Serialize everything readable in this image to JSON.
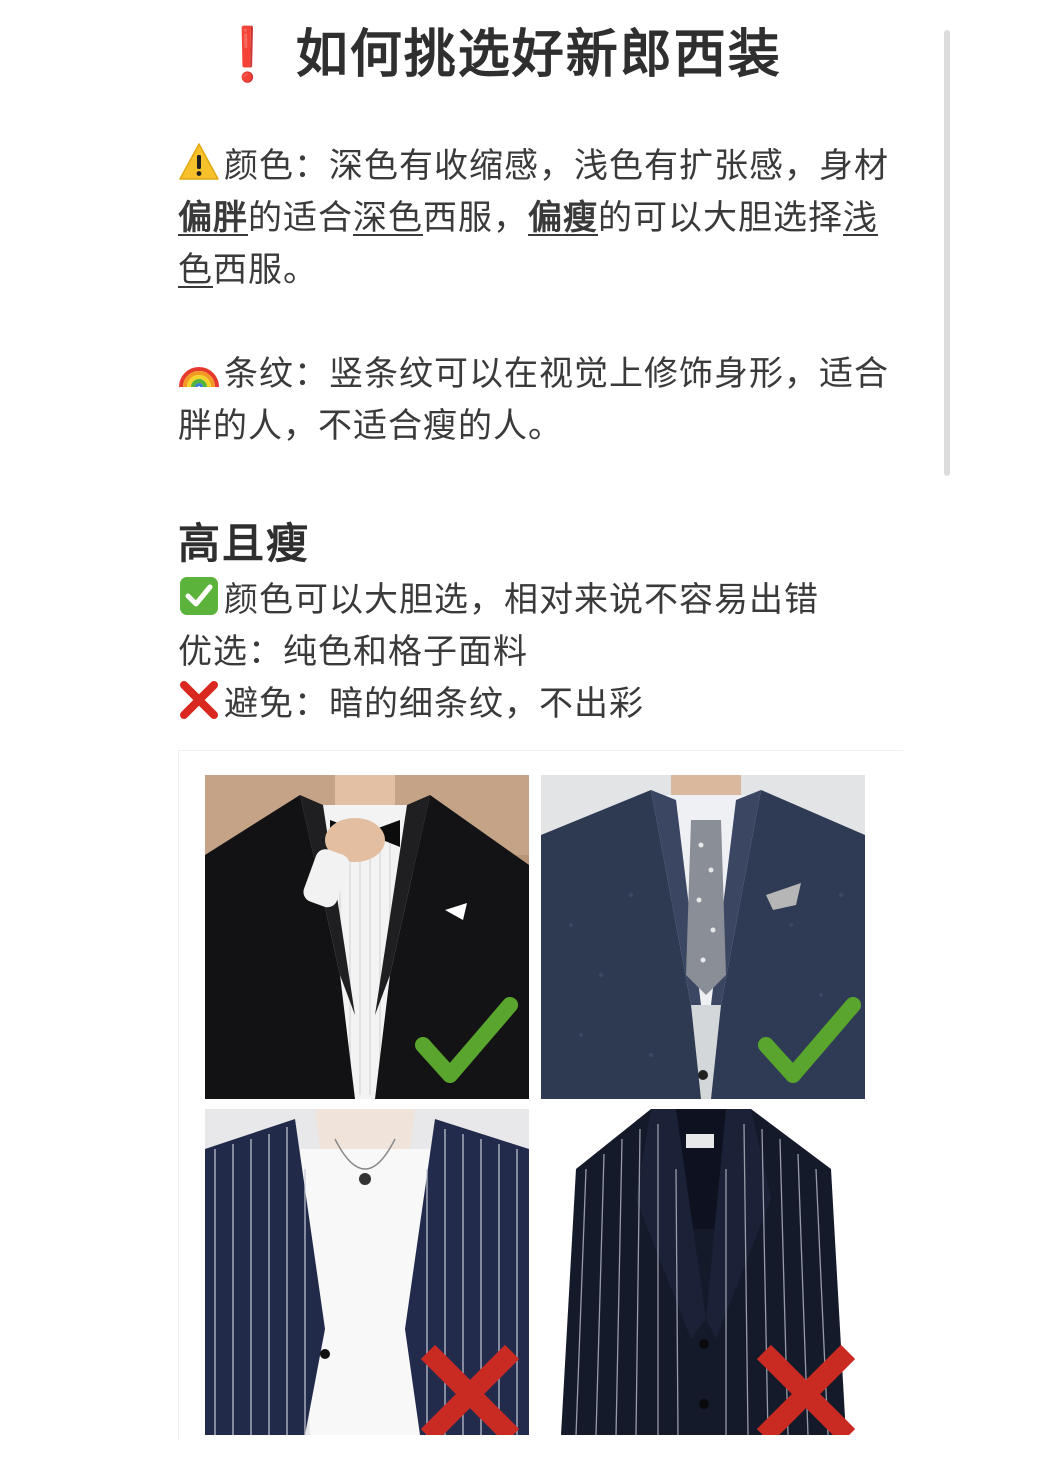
{
  "header": {
    "title_mark": "❗",
    "title": "如何挑选好新郎西装"
  },
  "color_tip": {
    "icon": "warning-icon",
    "p1": "颜色：深色有收缩感，浅色有扩张感，身材",
    "p2": "偏胖",
    "p3": "的适合",
    "p4": "深色",
    "p5": "西服，",
    "p6": "偏瘦",
    "p7": "的可以大胆选择",
    "p8": "浅色",
    "p9": "西服。"
  },
  "stripe_tip": {
    "icon": "rainbow-icon",
    "text": "条纹：竖条纹可以在视觉上修饰身形，适合胖的人，不适合瘦的人。"
  },
  "section": {
    "heading": "高且瘦",
    "do_icon": "check-box-icon",
    "do_text": "颜色可以大胆选，相对来说不容易出错",
    "prefer_text": "优选：纯色和格子面料",
    "avoid_icon": "cross-mark-icon",
    "avoid_text": "避免：暗的细条纹，不出彩"
  },
  "photos": [
    {
      "name": "black-tuxedo-photo",
      "verdict": "good"
    },
    {
      "name": "navy-tweed-suit-photo",
      "verdict": "good"
    },
    {
      "name": "navy-pinstripe-blazer-photo",
      "verdict": "bad"
    },
    {
      "name": "dark-pinstripe-jacket-photo",
      "verdict": "bad"
    }
  ],
  "colors": {
    "accent_red": "#d8281f",
    "check_green": "#5aa52d",
    "cross_red": "#c92a22"
  }
}
